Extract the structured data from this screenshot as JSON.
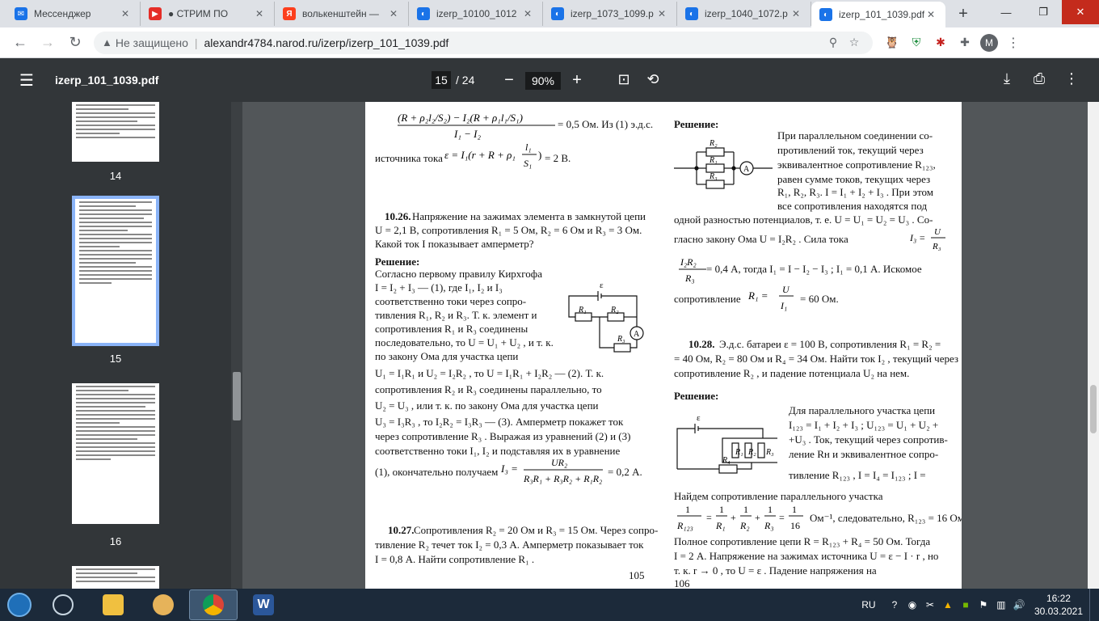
{
  "tabs": [
    {
      "title": "Мессенджер",
      "color": "#1a73e8",
      "glyph": "✉"
    },
    {
      "title": "● СТРИМ ПО",
      "color": "#e52d27",
      "glyph": "▶"
    },
    {
      "title": "волькенштейн — ",
      "color": "#fc3f1d",
      "glyph": "Я"
    },
    {
      "title": "izerp_10100_1012",
      "color": "#1a73e8",
      "glyph": "◐"
    },
    {
      "title": "izerp_1073_1099.p",
      "color": "#1a73e8",
      "glyph": "◐"
    },
    {
      "title": "izerp_1040_1072.p",
      "color": "#1a73e8",
      "glyph": "◐"
    },
    {
      "title": "izerp_101_1039.pdf",
      "color": "#1a73e8",
      "glyph": "◐"
    }
  ],
  "address": {
    "security": "Не защищено",
    "url": "alexandr4784.narod.ru/izerp/izerp_101_1039.pdf"
  },
  "profile": "M",
  "pdf": {
    "filename": "izerp_101_1039.pdf",
    "page": "15",
    "total": "/ 24",
    "zoom": "90%"
  },
  "thumbs": [
    "14",
    "15",
    "16"
  ],
  "page1": {
    "top_frac": "= 0,5 Ом. Из (1) э.д.с.",
    "emf_prefix": "источника тока",
    "emf_result": "= 2 В.",
    "p26_head": "10.26.",
    "p26_l1": "Напряжение на зажимах элемента в замкнутой цепи",
    "p26_l2": "U = 2,1 В,  сопротивления   R₁ = 5 Ом,   R₂ = 6 Ом   и   R₃ = 3 Ом.",
    "p26_l3": "Какой ток  I  показывает амперметр?",
    "sol": "Решение:",
    "s1": "Согласно первому правилу Кирхгофа",
    "s2": "I = I₂ + I₃   — (1),  где   I₁,   I₂   и   I₃",
    "s3": "соответственно  токи  через  сопро-",
    "s4": "тивления  R₁,  R₂ и  R₃.  Т. к. элемент и",
    "s5": "сопротивления    R₁    и    R₃    соединены",
    "s6": "последовательно, то  U = U₁ + U₂ ,  и т. к.",
    "s7": "по   закону   Ома   для   участка   цепи",
    "s8": "U₁ = I₁R₁   и   U₂ = I₂R₂ ,  то   U = I₁R₁ + I₂R₂   — (2).  Т. к.",
    "s9": "сопротивления   R₂   и   R₃   соединены   параллельно,   то",
    "s10": "U₂ = U₃ ,  или  т. к.  по  закону  Ома  для  участка  цепи",
    "s11": "U₃ = I₃R₃ ,  то   I₂R₂ = I₃R₃  — (3).  Амперметр покажет ток",
    "s12": "через сопротивление  R₃ .  Выражая из уравнений (2) и (3)",
    "s13": "соответственно  токи   I₁,   I₂   и подставляя их в уравнение",
    "s14": "(1), окончательно получаем",
    "s14_res": "= 0,2 А.",
    "p27_head": "10.27.",
    "p27_l1": "Сопротивления  R₂ = 20 Ом и  R₃ = 15 Ом.  Через сопро-",
    "p27_l2": "тивление  R₂  течет ток  I₂ = 0,3 А.  Амперметр показывает ток",
    "p27_l3": "I = 0,8 А.  Найти сопротивление  R₁ .",
    "pnum": "105"
  },
  "page2": {
    "sol": "Решение:",
    "a1": "При   параллельном  соединении  со-",
    "a2": "противлений  ток,  текущий  через",
    "a3": "эквивалентное  сопротивление  R₁₂₃,",
    "a4": "равен  сумме  токов,  текущих  через",
    "a5": "R₁,  R₂,  R₃.  I = I₁ + I₂ + I₃ .  При этом",
    "a6": "все  сопротивления  находятся  под",
    "a7": "одной разностью  потенциалов,  т. е.   U = U₁ = U₂ = U₃ .  Со-",
    "a8": "гласно   закону   Ома    U = I₂R₂ .   Сила   тока",
    "a9": "= 0,4 А,   тогда    I₁ = I − I₂ − I₃ ;    I₁ = 0,1 А.   Искомое",
    "a10": "сопротивление",
    "a10_res": "= 60 Ом.",
    "p28_head": "10.28.",
    "p28_l1": "Э.д.с.  батареи   ε = 100 В,  сопротивления   R₁ = R₂ =",
    "p28_l2": "= 40 Ом,  R₂ = 80 Ом и  R₄ = 34 Ом.  Найти ток  I₂ ,  текущий через",
    "p28_l3": "сопротивление  R₂ ,  и падение потенциала  U₂  на нем.",
    "sol2": "Решение:",
    "c1": "Для  параллельного  участка  цепи",
    "c2": "I₁₂₃ = I₁ + I₂ + I₃ ;      U₁₂₃ = U₁ + U₂ +",
    "c3": "+U₃ .  Ток, текущий через сопротив-",
    "c4": "ление  Rн  и  эквивалентное  сопро-",
    "c5": "тивление   R₁₂₃ ,   I = I₄ = I₁₂₃ ;   I =",
    "c6": "Найдем        сопротивление        параллельного        участка",
    "c7": "Ом⁻¹,   следовательно,    R₁₂₃ = 16 Ом.",
    "c8": "Полное  сопротивление  цепи    R = R₁₂₃ + R₄ = 50 Ом.   Тогда",
    "c9": "I = 2 А. Напряжение на зажимах источника  U = ε − I · r ,  но",
    "c10": "т. к.     r → 0 ,     то     U = ε .     Падение    напряжения    на",
    "c11": "106"
  },
  "taskbar": {
    "lang": "RU",
    "time": "16:22",
    "date": "30.03.2021"
  }
}
